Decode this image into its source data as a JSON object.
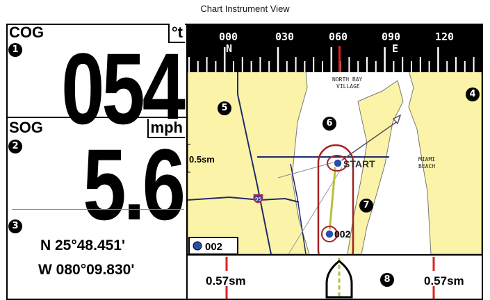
{
  "caption": "Chart Instrument View",
  "cog": {
    "label": "COG",
    "unit": "°t",
    "value": "054",
    "callout": "1"
  },
  "sog": {
    "label": "SOG",
    "unit": "mph",
    "value": "5.6",
    "callout": "2"
  },
  "position": {
    "callout": "3",
    "lat": "N 25°48.451'",
    "lon": "W 080°09.830'"
  },
  "compass": {
    "headings": [
      "000",
      "030",
      "060",
      "090",
      "120"
    ],
    "cardinals": {
      "N": "N",
      "E": "E"
    },
    "callout": "4"
  },
  "map": {
    "callout_chart": "5",
    "callout_boat": "6",
    "callout_track": "7",
    "scale": "0.5sm",
    "place_north_bay": [
      "NORTH BAY",
      "VILLAGE"
    ],
    "place_miami": [
      "MIAMI",
      "BEACH"
    ],
    "waypoint_start": "START",
    "waypoint_002": "002",
    "road_shield": "95",
    "active_waypoint": "002"
  },
  "course_bar": {
    "left_distance": "0.57sm",
    "right_distance": "0.57sm",
    "callout": "8"
  },
  "colors": {
    "land": "#fbf3a8",
    "water": "#ffffff",
    "route": "#a32222",
    "road": "#1f2a6b",
    "track": "#b8c03a"
  }
}
